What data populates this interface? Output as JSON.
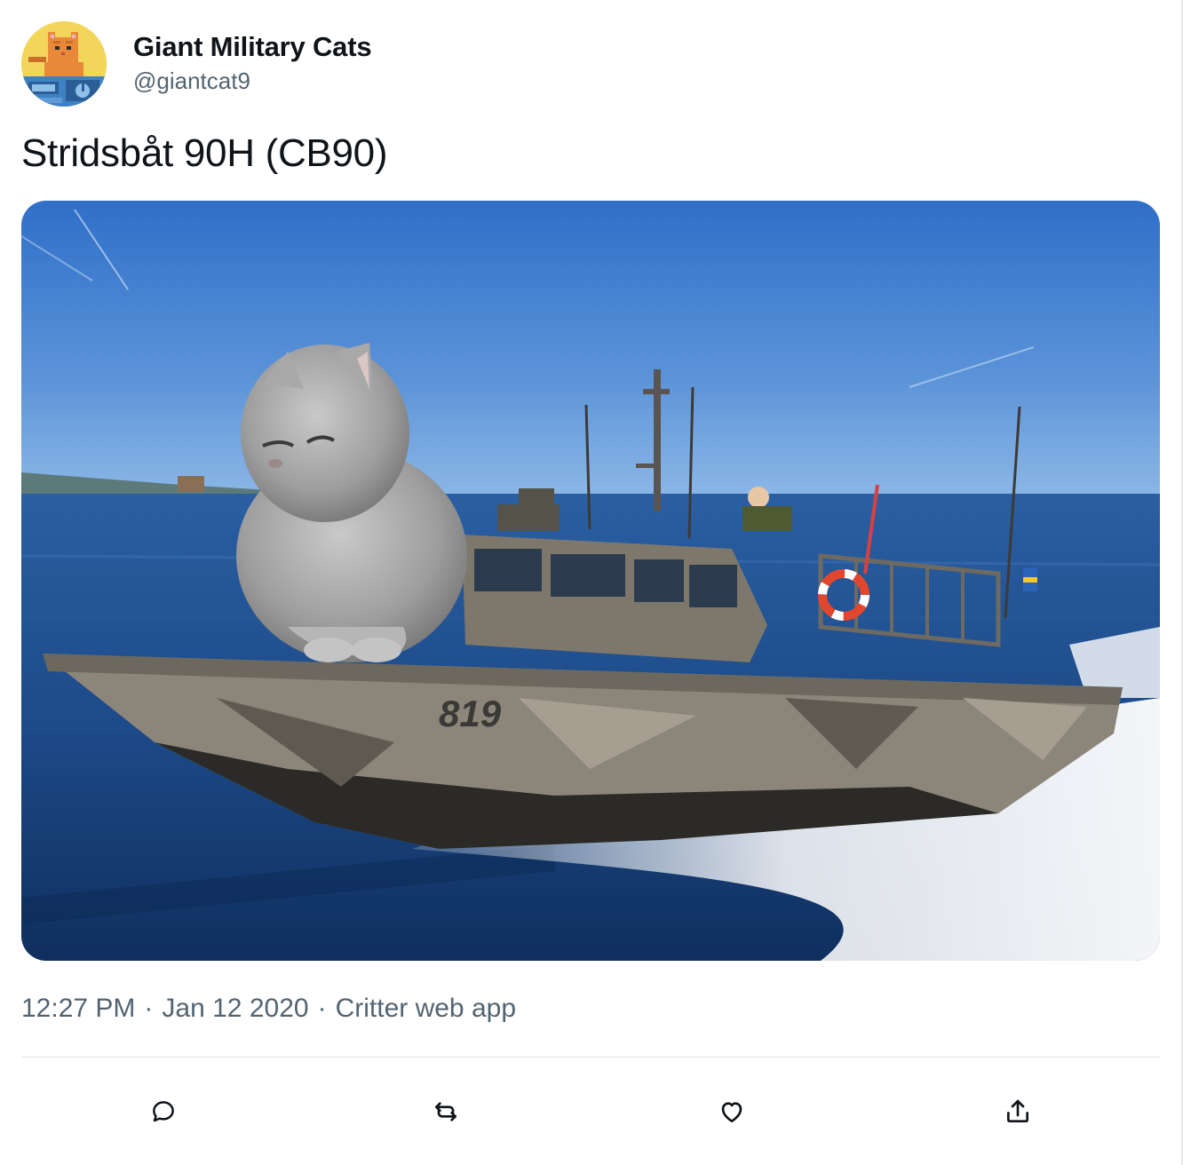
{
  "author": {
    "display_name": "Giant Military Cats",
    "handle": "@giantcat9",
    "avatar_alt": "pixel art cat avatar"
  },
  "tweet": {
    "text": "Stridsbåt 90H (CB90)",
    "media": {
      "boat_hull_number": "819"
    },
    "time": "12:27 PM",
    "date": "Jan 12 2020",
    "source": "Critter web app",
    "separator": "·"
  },
  "actions": [
    {
      "name": "reply",
      "icon": "reply-icon"
    },
    {
      "name": "retweet",
      "icon": "retweet-icon"
    },
    {
      "name": "like",
      "icon": "heart-icon"
    },
    {
      "name": "share",
      "icon": "share-icon"
    }
  ],
  "colors": {
    "text_primary": "#0f1419",
    "text_secondary": "#536471",
    "divider": "#e1e6ea",
    "sky": "#3f7fd0",
    "water": "#1e4a86"
  }
}
